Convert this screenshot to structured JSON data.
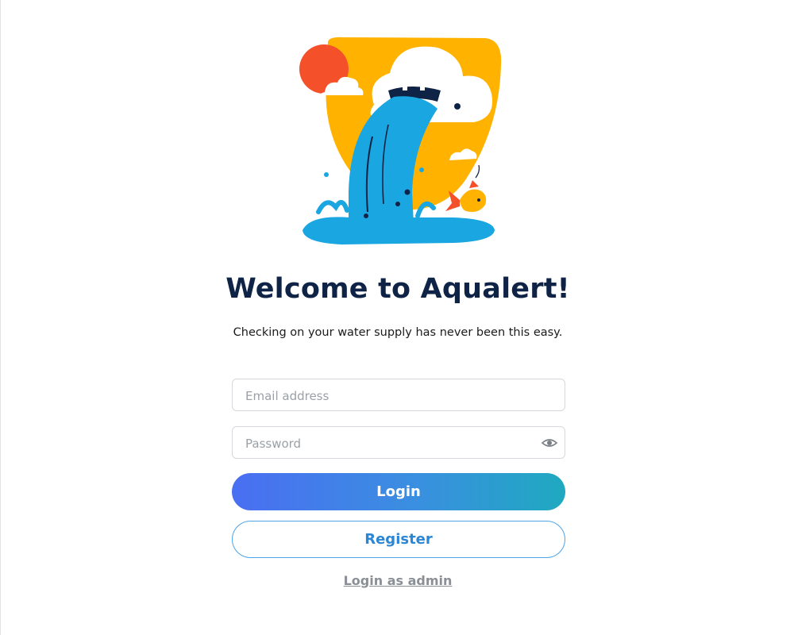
{
  "app": {
    "title": "Welcome to Aqualert!",
    "subtitle": "Checking on your water supply has never been this easy."
  },
  "form": {
    "email": {
      "value": "",
      "placeholder": "Email address"
    },
    "password": {
      "value": "",
      "placeholder": "Password",
      "toggle_icon": "eye-icon"
    }
  },
  "actions": {
    "login_label": "Login",
    "register_label": "Register",
    "admin_label": "Login as admin"
  },
  "colors": {
    "title": "#0f2346",
    "login_gradient_start": "#4a6ef2",
    "login_gradient_end": "#1fa9c0",
    "register_text": "#2b86d6",
    "admin_link": "#8a8f96",
    "illustration_yellow": "#ffb300",
    "illustration_sun": "#f4502a",
    "illustration_water": "#1aa6e0"
  },
  "illustration": {
    "icon": "waterfall-pipe-illustration"
  }
}
